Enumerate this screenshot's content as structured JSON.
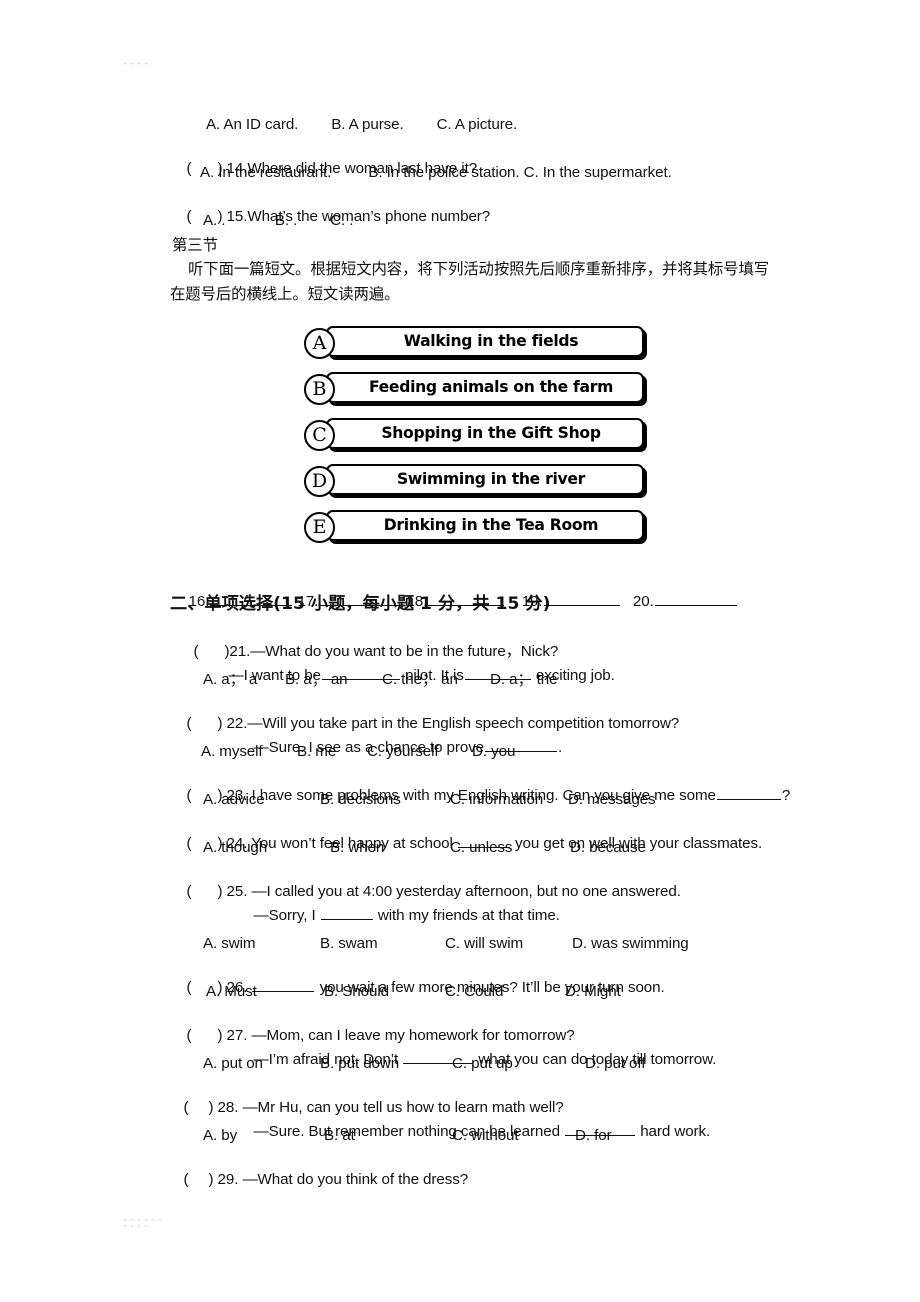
{
  "document": {
    "type": "english-exam-paper",
    "listening_tail": {
      "q13_options": "A. An ID card.        B. A purse.        C. A picture.",
      "q14_stem": ") 14.Where did the woman last have it?",
      "q14_options": "A. In the restaurant.         B. In the police station. C. In the supermarket.",
      "q15_stem": ") 15.What’s the woman’s phone number?",
      "q15_options": "A. .            B. .        C. ."
    },
    "section_three": {
      "label": "第三节",
      "instruction_line1": "听下面一篇短文。根据短文内容，将下列活动按照先后顺序重新排序，并将其标号填写",
      "instruction_line2": "在题号后的横线上。短文读两遍。"
    },
    "activities": [
      {
        "letter": "A",
        "label": "Walking in the fields"
      },
      {
        "letter": "B",
        "label": "Feeding animals on the farm"
      },
      {
        "letter": "C",
        "label": "Shopping in the Gift Shop"
      },
      {
        "letter": "D",
        "label": "Swimming in the river"
      },
      {
        "letter": "E",
        "label": "Drinking in the Tea Room"
      }
    ],
    "answer_blanks": [
      {
        "number": "16."
      },
      {
        "number": "17."
      },
      {
        "number": "18."
      },
      {
        "number": "19."
      },
      {
        "number": "20."
      }
    ],
    "section_two": {
      "heading": "二、单项选择(15 小题，每小题 1 分，共 15 分)"
    },
    "questions": [
      {
        "id": "21",
        "stem": ")21.—What do you want to be in the future，Nick?",
        "reply_pre": "—I want to be",
        "reply_mid": " pilot. It is",
        "reply_post": " exciting job.",
        "options": [
          "A. a； a",
          "B. a； an",
          "C. the； an",
          "D. a； the"
        ]
      },
      {
        "id": "22",
        "stem": ") 22.—Will you take part in the English speech competition tomorrow?",
        "reply_pre": "—Sure. I see as a chance to prove",
        "reply_post": ".",
        "options": [
          "A. myself",
          "B. me",
          "C. yourself",
          "D. you"
        ]
      },
      {
        "id": "23",
        "stem_pre": ") 23. I have some problems with my English writing. Can you give me some",
        "stem_post": "?",
        "options": [
          "A. advice",
          "B. decisions",
          "C. information",
          "D. messages"
        ]
      },
      {
        "id": "24",
        "stem_pre": ") 24. You won’t feel happy at school ",
        "stem_post": " you get on well with your classmates.",
        "options": [
          "A. though",
          "B. when",
          "C. unless",
          "D. because"
        ]
      },
      {
        "id": "25",
        "stem": ") 25. —I called you at 4:00 yesterday afternoon, but no one answered.",
        "reply_pre": "—Sorry, I ",
        "reply_post": " with my friends at that time.",
        "options": [
          "A. swim",
          "B. swam",
          "C. will swim",
          "D. was swimming"
        ]
      },
      {
        "id": "26",
        "stem_pre": ") 26. ",
        "stem_post": " you wait a few more minutes? It’ll be your turn soon.",
        "options": [
          "A. Must",
          "B. Should",
          "C. Could",
          "D. Might"
        ]
      },
      {
        "id": "27",
        "stem": ") 27. —Mom, can I leave my homework for tomorrow?",
        "reply_pre": "—I’m afraid not. Don’t ",
        "reply_post": " what you can do today till tomorrow.",
        "options": [
          "A. put on",
          "B. put down",
          "C. put up",
          "D. put off"
        ]
      },
      {
        "id": "28",
        "stem": ") 28. —Mr Hu, can you tell us how to learn math well?",
        "reply_pre": "—Sure. But remember nothing can be learned ",
        "reply_post": " hard work.",
        "options": [
          "A. by",
          "B. at",
          "C. without",
          "D. for"
        ]
      },
      {
        "id": "29",
        "stem": ") 29. —What do you think of the dress?",
        "options": []
      }
    ],
    "artifacts": {
      "top_mark": "• • • •",
      "bottom_mark": "• • • • • •\n• • • •"
    }
  }
}
